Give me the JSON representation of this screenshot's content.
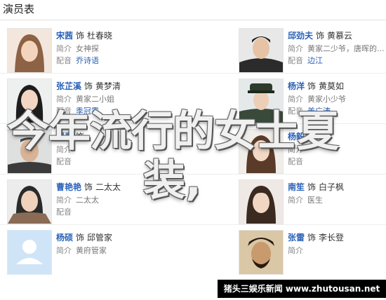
{
  "header": {
    "title": "演员表"
  },
  "cast": [
    {
      "name": "宋茜",
      "role_prefix": "饰",
      "role": "杜春晓",
      "intro_label": "简介",
      "intro": "女神探",
      "dub_label": "配音",
      "dub": "乔诗语"
    },
    {
      "name": "邱劲夫",
      "role_prefix": "饰",
      "role": "黄慕云",
      "intro_label": "简介",
      "intro": "黄家二少爷，唐晖的...",
      "dub_label": "配音",
      "dub": "边江"
    },
    {
      "name": "张芷溪",
      "role_prefix": "饰",
      "role": "黄梦清",
      "intro_label": "简介",
      "intro": "黄家二小姐",
      "dub_label": "配音",
      "dub": "季冠霖"
    },
    {
      "name": "杨洋",
      "role_prefix": "饰",
      "role": "黄莫如",
      "intro_label": "简介",
      "intro": "黄家小少爷",
      "dub_label": "配音",
      "dub": "姜广涛"
    },
    {
      "name": "贾青",
      "role_prefix": "饰",
      "role": "",
      "intro_label": "简介",
      "intro": "",
      "dub_label": "配音",
      "dub": ""
    },
    {
      "name": "杨毅",
      "role_prefix": "饰",
      "role": "",
      "intro_label": "简介",
      "intro": "",
      "dub_label": "配音",
      "dub": ""
    },
    {
      "name": "曹艳艳",
      "role_prefix": "饰",
      "role": "二太太",
      "intro_label": "简介",
      "intro": "二太太",
      "dub_label": "配音",
      "dub": ""
    },
    {
      "name": "南笙",
      "role_prefix": "饰",
      "role": "白子枫",
      "intro_label": "简介",
      "intro": "医生",
      "dub_label": "",
      "dub": ""
    },
    {
      "name": "杨硕",
      "role_prefix": "饰",
      "role": "邱管家",
      "intro_label": "简介",
      "intro": "黄府管家",
      "dub_label": "",
      "dub": ""
    },
    {
      "name": "张雷",
      "role_prefix": "饰",
      "role": "李长登",
      "intro_label": "简介",
      "intro": "",
      "dub_label": "",
      "dub": ""
    }
  ],
  "overlay": {
    "line1": "今年流行的女士夏",
    "line2": "装,"
  },
  "watermark": {
    "text": "猪头三娱乐新闻 www.zhutousan.net"
  },
  "colors": {
    "name_link": "#2a62b8",
    "placeholder_avatar": "#cfe5f7"
  },
  "icons": {
    "avatar_placeholder": "person-silhouette-icon"
  }
}
